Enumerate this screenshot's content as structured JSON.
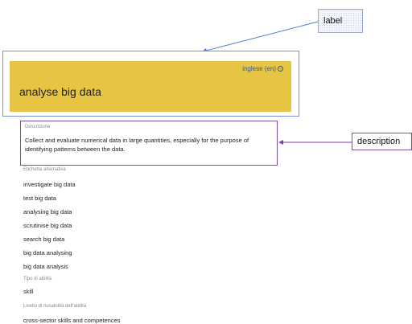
{
  "callouts": {
    "label": "label",
    "description": "description"
  },
  "label_card": {
    "language": "inglese (en)",
    "language_icon": "circle-minus-icon",
    "title": "analyse big data",
    "accent_color": "#e6c545"
  },
  "description": {
    "caption": "Descrizione",
    "text": "Collect and evaluate numerical data in large quantities, especially for the purpose of identifying patterns between the data."
  },
  "alternative_labels": {
    "caption": "Etichetta alternativa",
    "items": [
      "investigate big data",
      "test big data",
      "analysing big data",
      "scrutinise big data",
      "search big data",
      "big data analysing",
      "big data analysis"
    ]
  },
  "skill_type": {
    "caption": "Tipo di abilità",
    "value": "skill"
  },
  "reuse_level": {
    "caption": "Livello di riusabilità dell'abilità",
    "value": "cross-sector skills and competences"
  }
}
